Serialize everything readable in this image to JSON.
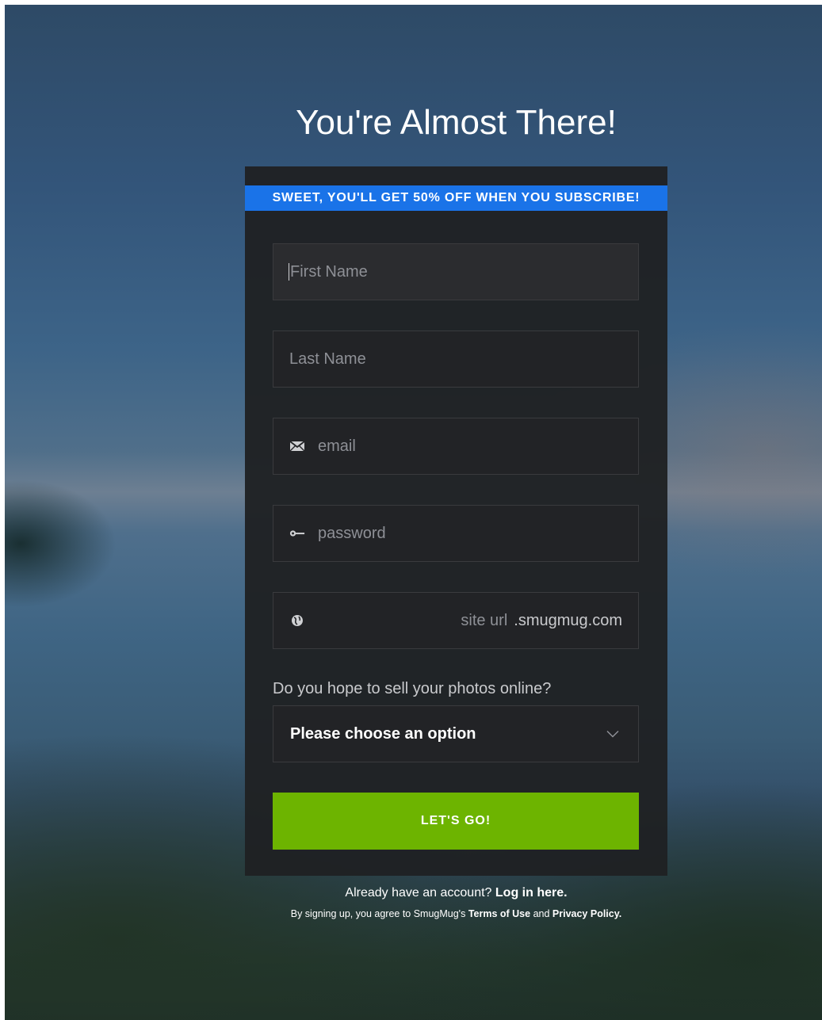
{
  "page": {
    "title": "You're Almost There!"
  },
  "banner": {
    "text": "SWEET, YOU'LL GET 50% OFF WHEN YOU SUBSCRIBE!"
  },
  "form": {
    "first_name": {
      "placeholder": "First Name",
      "icon": "none"
    },
    "last_name": {
      "placeholder": "Last Name",
      "icon": "none"
    },
    "email": {
      "placeholder": "email",
      "icon": "envelope-icon"
    },
    "password": {
      "placeholder": "password",
      "icon": "key-icon"
    },
    "site_url": {
      "placeholder": "site url",
      "domain_suffix": ".smugmug.com",
      "icon": "globe-icon"
    },
    "sell_question": "Do you hope to sell your photos online?",
    "sell_select": {
      "selected": "Please choose an option",
      "icon": "chevron-down-icon"
    },
    "submit_label": "LET'S GO!"
  },
  "footer": {
    "have_account": "Already have an account?",
    "login_link": "Log in here.",
    "agree_prefix": "By signing up, you agree to SmugMug's",
    "terms_link": "Terms of Use",
    "and_text": "and",
    "privacy_link": "Privacy Policy."
  },
  "colors": {
    "banner": "#1a73e8",
    "submit": "#6db400",
    "card": "#1f2123",
    "field": "#222326"
  }
}
